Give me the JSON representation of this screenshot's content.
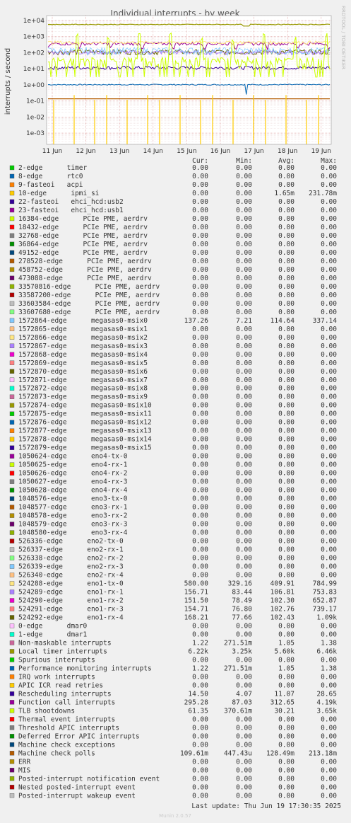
{
  "chart_data": {
    "type": "line",
    "title": "Individual interrupts - by week",
    "ylabel": "interrupts / second",
    "yscale": "log",
    "ylim": [
      0.0002,
      20000
    ],
    "yticks": [
      "1e+04",
      "1e+03",
      "1e+02",
      "1e+01",
      "1e+00",
      "1e-01",
      "1e-02",
      "1e-03"
    ],
    "ytick_values": [
      10000,
      1000,
      100,
      10,
      1,
      0.1,
      0.01,
      0.001
    ],
    "xticks": [
      "11 Jun",
      "12 Jun",
      "13 Jun",
      "14 Jun",
      "15 Jun",
      "16 Jun",
      "17 Jun",
      "18 Jun",
      "19 Jun"
    ],
    "grid": true,
    "side_label": "RRDTOOL / TOBI OETIKER",
    "columns": [
      "Cur:",
      "Min:",
      "Avg:",
      "Max:"
    ],
    "series": [
      {
        "c": "#00cc00",
        "name": "2-edge      timer",
        "v": [
          "0.00",
          "0.00",
          "0.00",
          "0.00"
        ]
      },
      {
        "c": "#0066b3",
        "name": "8-edge      rtc0",
        "v": [
          "0.00",
          "0.00",
          "0.00",
          "0.00"
        ]
      },
      {
        "c": "#ff8000",
        "name": "9-fasteoi   acpi",
        "v": [
          "0.00",
          "0.00",
          "0.00",
          "0.00"
        ]
      },
      {
        "c": "#ffcc00",
        "name": "10-edge      ipmi_si",
        "v": [
          "0.00",
          "0.00",
          "1.65m",
          "231.78m"
        ]
      },
      {
        "c": "#330099",
        "name": "22-fasteoi   ehci_hcd:usb2",
        "v": [
          "0.00",
          "0.00",
          "0.00",
          "0.00"
        ]
      },
      {
        "c": "#990099",
        "name": "23-fasteoi   ehci_hcd:usb1",
        "v": [
          "0.00",
          "0.00",
          "0.00",
          "0.00"
        ]
      },
      {
        "c": "#ccff00",
        "name": "16384-edge      PCIe PME, aerdrv",
        "v": [
          "0.00",
          "0.00",
          "0.00",
          "0.00"
        ]
      },
      {
        "c": "#ff0000",
        "name": "18432-edge      PCIe PME, aerdrv",
        "v": [
          "0.00",
          "0.00",
          "0.00",
          "0.00"
        ]
      },
      {
        "c": "#808080",
        "name": "32768-edge      PCIe PME, aerdrv",
        "v": [
          "0.00",
          "0.00",
          "0.00",
          "0.00"
        ]
      },
      {
        "c": "#008f00",
        "name": "36864-edge      PCIe PME, aerdrv",
        "v": [
          "0.00",
          "0.00",
          "0.00",
          "0.00"
        ]
      },
      {
        "c": "#00487d",
        "name": "49152-edge      PCIe PME, aerdrv",
        "v": [
          "0.00",
          "0.00",
          "0.00",
          "0.00"
        ]
      },
      {
        "c": "#b35a00",
        "name": "278528-edge      PCIe PME, aerdrv",
        "v": [
          "0.00",
          "0.00",
          "0.00",
          "0.00"
        ]
      },
      {
        "c": "#b38f00",
        "name": "458752-edge      PCIe PME, aerdrv",
        "v": [
          "0.00",
          "0.00",
          "0.00",
          "0.00"
        ]
      },
      {
        "c": "#6b006b",
        "name": "473088-edge      PCIe PME, aerdrv",
        "v": [
          "0.00",
          "0.00",
          "0.00",
          "0.00"
        ]
      },
      {
        "c": "#8fb300",
        "name": "33570816-edge      PCIe PME, aerdrv",
        "v": [
          "0.00",
          "0.00",
          "0.00",
          "0.00"
        ]
      },
      {
        "c": "#b30000",
        "name": "33587200-edge      PCIe PME, aerdrv",
        "v": [
          "0.00",
          "0.00",
          "0.00",
          "0.00"
        ]
      },
      {
        "c": "#bebebe",
        "name": "33603584-edge      PCIe PME, aerdrv",
        "v": [
          "0.00",
          "0.00",
          "0.00",
          "0.00"
        ]
      },
      {
        "c": "#80ff80",
        "name": "33607680-edge      PCIe PME, aerdrv",
        "v": [
          "0.00",
          "0.00",
          "0.00",
          "0.00"
        ]
      },
      {
        "c": "#80c9ff",
        "name": "1572864-edge      megasas0-msix0",
        "v": [
          "137.26",
          "7.21",
          "114.64",
          "337.14"
        ]
      },
      {
        "c": "#ffc080",
        "name": "1572865-edge      megasas0-msix1",
        "v": [
          "0.00",
          "0.00",
          "0.00",
          "0.00"
        ]
      },
      {
        "c": "#ffe680",
        "name": "1572866-edge      megasas0-msix2",
        "v": [
          "0.00",
          "0.00",
          "0.00",
          "0.00"
        ]
      },
      {
        "c": "#aa80ff",
        "name": "1572867-edge      megasas0-msix3",
        "v": [
          "0.00",
          "0.00",
          "0.00",
          "0.00"
        ]
      },
      {
        "c": "#ee00cc",
        "name": "1572868-edge      megasas0-msix4",
        "v": [
          "0.00",
          "0.00",
          "0.00",
          "0.00"
        ]
      },
      {
        "c": "#ff8080",
        "name": "1572869-edge      megasas0-msix5",
        "v": [
          "0.00",
          "0.00",
          "0.00",
          "0.00"
        ]
      },
      {
        "c": "#666600",
        "name": "1572870-edge      megasas0-msix6",
        "v": [
          "0.00",
          "0.00",
          "0.00",
          "0.00"
        ]
      },
      {
        "c": "#ffbfff",
        "name": "1572871-edge      megasas0-msix7",
        "v": [
          "0.00",
          "0.00",
          "0.00",
          "0.00"
        ]
      },
      {
        "c": "#00ffcc",
        "name": "1572872-edge      megasas0-msix8",
        "v": [
          "0.00",
          "0.00",
          "0.00",
          "0.00"
        ]
      },
      {
        "c": "#cc6699",
        "name": "1572873-edge      megasas0-msix9",
        "v": [
          "0.00",
          "0.00",
          "0.00",
          "0.00"
        ]
      },
      {
        "c": "#999900",
        "name": "1572874-edge      megasas0-msix10",
        "v": [
          "0.00",
          "0.00",
          "0.00",
          "0.00"
        ]
      },
      {
        "c": "#00cc00",
        "name": "1572875-edge      megasas0-msix11",
        "v": [
          "0.00",
          "0.00",
          "0.00",
          "0.00"
        ]
      },
      {
        "c": "#0066b3",
        "name": "1572876-edge      megasas0-msix12",
        "v": [
          "0.00",
          "0.00",
          "0.00",
          "0.00"
        ]
      },
      {
        "c": "#ff8000",
        "name": "1572877-edge      megasas0-msix13",
        "v": [
          "0.00",
          "0.00",
          "0.00",
          "0.00"
        ]
      },
      {
        "c": "#ffcc00",
        "name": "1572878-edge      megasas0-msix14",
        "v": [
          "0.00",
          "0.00",
          "0.00",
          "0.00"
        ]
      },
      {
        "c": "#330099",
        "name": "1572879-edge      megasas0-msix15",
        "v": [
          "0.00",
          "0.00",
          "0.00",
          "0.00"
        ]
      },
      {
        "c": "#990099",
        "name": "1050624-edge      eno4-tx-0",
        "v": [
          "0.00",
          "0.00",
          "0.00",
          "0.00"
        ]
      },
      {
        "c": "#ccff00",
        "name": "1050625-edge      eno4-rx-1",
        "v": [
          "0.00",
          "0.00",
          "0.00",
          "0.00"
        ]
      },
      {
        "c": "#ff0000",
        "name": "1050626-edge      eno4-rx-2",
        "v": [
          "0.00",
          "0.00",
          "0.00",
          "0.00"
        ]
      },
      {
        "c": "#808080",
        "name": "1050627-edge      eno4-rx-3",
        "v": [
          "0.00",
          "0.00",
          "0.00",
          "0.00"
        ]
      },
      {
        "c": "#008f00",
        "name": "1050628-edge      eno4-rx-4",
        "v": [
          "0.00",
          "0.00",
          "0.00",
          "0.00"
        ]
      },
      {
        "c": "#00487d",
        "name": "1048576-edge      eno3-tx-0",
        "v": [
          "0.00",
          "0.00",
          "0.00",
          "0.00"
        ]
      },
      {
        "c": "#b35a00",
        "name": "1048577-edge      eno3-rx-1",
        "v": [
          "0.00",
          "0.00",
          "0.00",
          "0.00"
        ]
      },
      {
        "c": "#b38f00",
        "name": "1048578-edge      eno3-rx-2",
        "v": [
          "0.00",
          "0.00",
          "0.00",
          "0.00"
        ]
      },
      {
        "c": "#6b006b",
        "name": "1048579-edge      eno3-rx-3",
        "v": [
          "0.00",
          "0.00",
          "0.00",
          "0.00"
        ]
      },
      {
        "c": "#8fb300",
        "name": "1048580-edge      eno3-rx-4",
        "v": [
          "0.00",
          "0.00",
          "0.00",
          "0.00"
        ]
      },
      {
        "c": "#b30000",
        "name": "526336-edge      eno2-tx-0",
        "v": [
          "0.00",
          "0.00",
          "0.00",
          "0.00"
        ]
      },
      {
        "c": "#bebebe",
        "name": "526337-edge      eno2-rx-1",
        "v": [
          "0.00",
          "0.00",
          "0.00",
          "0.00"
        ]
      },
      {
        "c": "#80ff80",
        "name": "526338-edge      eno2-rx-2",
        "v": [
          "0.00",
          "0.00",
          "0.00",
          "0.00"
        ]
      },
      {
        "c": "#80c9ff",
        "name": "526339-edge      eno2-rx-3",
        "v": [
          "0.00",
          "0.00",
          "0.00",
          "0.00"
        ]
      },
      {
        "c": "#ffc080",
        "name": "526340-edge      eno2-rx-4",
        "v": [
          "0.00",
          "0.00",
          "0.00",
          "0.00"
        ]
      },
      {
        "c": "#ffe680",
        "name": "524288-edge      eno1-tx-0",
        "v": [
          "580.00",
          "329.16",
          "409.91",
          "784.99"
        ]
      },
      {
        "c": "#aa80ff",
        "name": "524289-edge      eno1-rx-1",
        "v": [
          "156.71",
          "83.44",
          "106.81",
          "753.83"
        ]
      },
      {
        "c": "#ee00cc",
        "name": "524290-edge      eno1-rx-2",
        "v": [
          "151.50",
          "78.49",
          "102.30",
          "652.87"
        ]
      },
      {
        "c": "#ff8080",
        "name": "524291-edge      eno1-rx-3",
        "v": [
          "154.71",
          "76.80",
          "102.76",
          "739.17"
        ]
      },
      {
        "c": "#666600",
        "name": "524292-edge      eno1-rx-4",
        "v": [
          "168.21",
          "77.66",
          "102.43",
          "1.09k"
        ]
      },
      {
        "c": "#ffbfff",
        "name": "0-edge      dmar0",
        "v": [
          "0.00",
          "0.00",
          "0.00",
          "0.00"
        ]
      },
      {
        "c": "#00ffcc",
        "name": "1-edge      dmar1",
        "v": [
          "0.00",
          "0.00",
          "0.00",
          "0.00"
        ]
      },
      {
        "c": "#cc6699",
        "name": "Non-maskable interrupts",
        "v": [
          "1.22",
          "271.51m",
          "1.05",
          "1.38"
        ]
      },
      {
        "c": "#999900",
        "name": "Local timer interrupts",
        "v": [
          "6.22k",
          "3.25k",
          "5.60k",
          "6.46k"
        ]
      },
      {
        "c": "#00cc00",
        "name": "Spurious interrupts",
        "v": [
          "0.00",
          "0.00",
          "0.00",
          "0.00"
        ]
      },
      {
        "c": "#0066b3",
        "name": "Performance monitoring interrupts",
        "v": [
          "1.22",
          "271.51m",
          "1.05",
          "1.38"
        ]
      },
      {
        "c": "#ff8000",
        "name": "IRQ work interrupts",
        "v": [
          "0.00",
          "0.00",
          "0.00",
          "0.00"
        ]
      },
      {
        "c": "#ffcc00",
        "name": "APIC ICR read retries",
        "v": [
          "0.00",
          "0.00",
          "0.00",
          "0.00"
        ]
      },
      {
        "c": "#330099",
        "name": "Rescheduling interrupts",
        "v": [
          "14.50",
          "4.07",
          "11.07",
          "28.65"
        ]
      },
      {
        "c": "#990099",
        "name": "Function call interrupts",
        "v": [
          "295.28",
          "87.03",
          "312.65",
          "4.19k"
        ]
      },
      {
        "c": "#ccff00",
        "name": "TLB shootdowns",
        "v": [
          "61.35",
          "370.61m",
          "30.21",
          "3.65k"
        ]
      },
      {
        "c": "#ff0000",
        "name": "Thermal event interrupts",
        "v": [
          "0.00",
          "0.00",
          "0.00",
          "0.00"
        ]
      },
      {
        "c": "#808080",
        "name": "Threshold APIC interrupts",
        "v": [
          "0.00",
          "0.00",
          "0.00",
          "0.00"
        ]
      },
      {
        "c": "#008f00",
        "name": "Deferred Error APIC interrupts",
        "v": [
          "0.00",
          "0.00",
          "0.00",
          "0.00"
        ]
      },
      {
        "c": "#00487d",
        "name": "Machine check exceptions",
        "v": [
          "0.00",
          "0.00",
          "0.00",
          "0.00"
        ]
      },
      {
        "c": "#b35a00",
        "name": "Machine check polls",
        "v": [
          "109.61m",
          "447.43u",
          "128.49m",
          "213.18m"
        ]
      },
      {
        "c": "#b38f00",
        "name": "ERR",
        "v": [
          "0.00",
          "0.00",
          "0.00",
          "0.00"
        ]
      },
      {
        "c": "#6b006b",
        "name": "MIS",
        "v": [
          "0.00",
          "0.00",
          "0.00",
          "0.00"
        ]
      },
      {
        "c": "#8fb300",
        "name": "Posted-interrupt notification event",
        "v": [
          "0.00",
          "0.00",
          "0.00",
          "0.00"
        ]
      },
      {
        "c": "#b30000",
        "name": "Nested posted-interrupt event",
        "v": [
          "0.00",
          "0.00",
          "0.00",
          "0.00"
        ]
      },
      {
        "c": "#bebebe",
        "name": "Posted-interrupt wakeup event",
        "v": [
          "0.00",
          "0.00",
          "0.00",
          "0.00"
        ]
      }
    ],
    "last_update": "Last update: Thu Jun 19 17:30:35 2025",
    "footer": "Munin 2.0.57"
  }
}
